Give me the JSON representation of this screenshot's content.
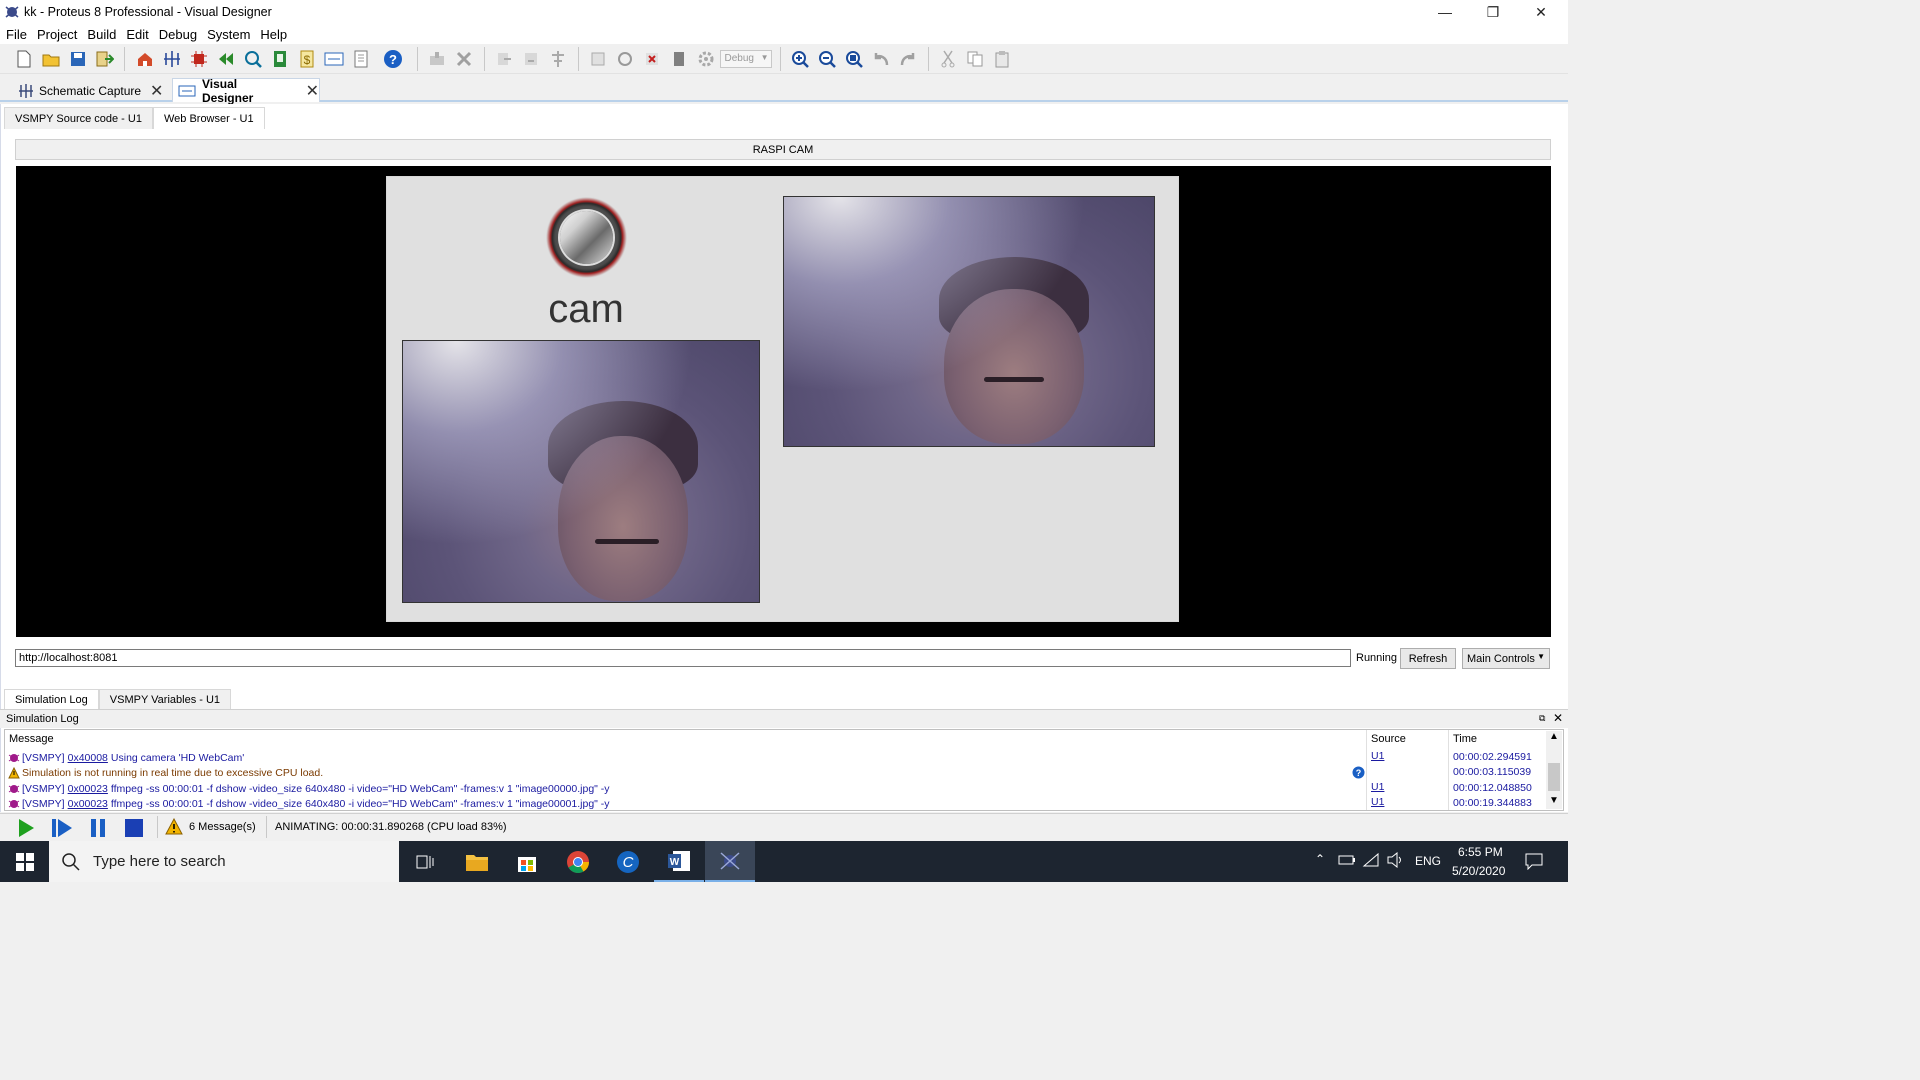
{
  "window": {
    "title": "kk - Proteus 8 Professional - Visual Designer",
    "controls": {
      "minimize": "—",
      "maximize": "❐",
      "close": "✕"
    }
  },
  "menu": [
    "File",
    "Project",
    "Build",
    "Edit",
    "Debug",
    "System",
    "Help"
  ],
  "toolbar": {
    "debug_select": "Debug",
    "icons_left": [
      "new-file-icon",
      "open-folder-icon",
      "save-icon",
      "import-icon",
      "home-icon",
      "schematic-icon",
      "pcb-icon",
      "gerber-icon",
      "3d-view-icon",
      "bom-icon",
      "dollar-icon",
      "vsm-icon",
      "notes-icon"
    ],
    "icons_right": [
      "zoom-in-icon",
      "zoom-out-icon",
      "zoom-fit-icon",
      "undo-icon",
      "redo-icon",
      "cut-icon",
      "copy-icon",
      "paste-icon"
    ]
  },
  "tabs": {
    "schematic": "Schematic Capture",
    "visual_designer": "Visual Designer"
  },
  "subtabs": [
    "VSMPY Source code - U1",
    "Web Browser - U1"
  ],
  "browser": {
    "header": "RASPI CAM",
    "cam_label": "cam",
    "url": "http://localhost:8081",
    "status": "Running",
    "refresh": "Refresh",
    "main_controls": "Main Controls"
  },
  "bottom_tabs": [
    "Simulation Log",
    "VSMPY Variables - U1"
  ],
  "log": {
    "title": "Simulation Log",
    "columns": {
      "message": "Message",
      "source": "Source",
      "time": "Time"
    },
    "rows": [
      {
        "prefix": "[VSMPY]",
        "addr": "0x40008",
        "text": "Using camera 'HD WebCam'",
        "source": "U1",
        "time": "00:00:02.294591",
        "kind": "vsmpy"
      },
      {
        "prefix": "",
        "addr": "",
        "text": "Simulation is not running in real time due to excessive CPU load.",
        "source": "",
        "time": "00:00:03.115039",
        "kind": "warning"
      },
      {
        "prefix": "[VSMPY]",
        "addr": "0x00023",
        "text": "ffmpeg -ss 00:00:01 -f dshow -video_size 640x480 -i video=\"HD WebCam\" -frames:v 1 \"image00000.jpg\" -y",
        "source": "U1",
        "time": "00:00:12.048850",
        "kind": "vsmpy"
      },
      {
        "prefix": "[VSMPY]",
        "addr": "0x00023",
        "text": "ffmpeg -ss 00:00:01 -f dshow -video_size 640x480 -i video=\"HD WebCam\" -frames:v 1 \"image00001.jpg\" -y",
        "source": "U1",
        "time": "00:00:19.344883",
        "kind": "vsmpy"
      }
    ]
  },
  "status": {
    "messages": "6 Message(s)",
    "animating": "ANIMATING: 00:00:31.890268 (CPU load 83%)"
  },
  "taskbar": {
    "search_placeholder": "Type here to search",
    "language": "ENG",
    "time": "6:55 PM",
    "date": "5/20/2020"
  },
  "colors": {
    "accent": "#0078d7",
    "play": "#1ea01e",
    "link": "#1a1aa0"
  }
}
